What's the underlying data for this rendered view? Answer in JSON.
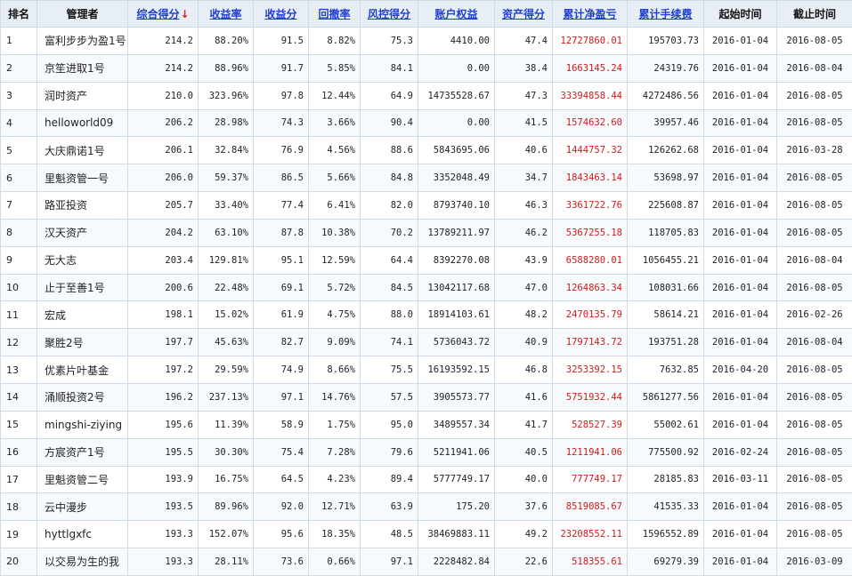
{
  "headers": {
    "rank": "排名",
    "manager": "管理者",
    "overall_score": "综合得分",
    "return_rate": "收益率",
    "return_score": "收益分",
    "drawdown": "回撤率",
    "risk_score": "风控得分",
    "equity": "账户权益",
    "asset_score": "资产得分",
    "cum_pnl": "累计净盈亏",
    "cum_fee": "累计手续费",
    "start_date": "起始时间",
    "end_date": "截止时间"
  },
  "sort_indicator": "↓",
  "rows": [
    {
      "rank": "1",
      "manager": "富利步步为盈1号",
      "overall": "214.2",
      "return_rate": "88.20%",
      "return_score": "91.5",
      "drawdown": "8.82%",
      "risk": "75.3",
      "equity": "4410.00",
      "asset": "47.4",
      "pnl": "12727860.01",
      "fee": "195703.73",
      "start": "2016-01-04",
      "end": "2016-08-05"
    },
    {
      "rank": "2",
      "manager": "京笙进取1号",
      "overall": "214.2",
      "return_rate": "88.96%",
      "return_score": "91.7",
      "drawdown": "5.85%",
      "risk": "84.1",
      "equity": "0.00",
      "asset": "38.4",
      "pnl": "1663145.24",
      "fee": "24319.76",
      "start": "2016-01-04",
      "end": "2016-08-04"
    },
    {
      "rank": "3",
      "manager": "润时资产",
      "overall": "210.0",
      "return_rate": "323.96%",
      "return_score": "97.8",
      "drawdown": "12.44%",
      "risk": "64.9",
      "equity": "14735528.67",
      "asset": "47.3",
      "pnl": "33394858.44",
      "fee": "4272486.56",
      "start": "2016-01-04",
      "end": "2016-08-05"
    },
    {
      "rank": "4",
      "manager": "helloworld09",
      "overall": "206.2",
      "return_rate": "28.98%",
      "return_score": "74.3",
      "drawdown": "3.66%",
      "risk": "90.4",
      "equity": "0.00",
      "asset": "41.5",
      "pnl": "1574632.60",
      "fee": "39957.46",
      "start": "2016-01-04",
      "end": "2016-08-05"
    },
    {
      "rank": "5",
      "manager": "大庆鼎诺1号",
      "overall": "206.1",
      "return_rate": "32.84%",
      "return_score": "76.9",
      "drawdown": "4.56%",
      "risk": "88.6",
      "equity": "5843695.06",
      "asset": "40.6",
      "pnl": "1444757.32",
      "fee": "126262.68",
      "start": "2016-01-04",
      "end": "2016-03-28"
    },
    {
      "rank": "6",
      "manager": "里魁资管一号",
      "overall": "206.0",
      "return_rate": "59.37%",
      "return_score": "86.5",
      "drawdown": "5.66%",
      "risk": "84.8",
      "equity": "3352048.49",
      "asset": "34.7",
      "pnl": "1843463.14",
      "fee": "53698.97",
      "start": "2016-01-04",
      "end": "2016-08-05"
    },
    {
      "rank": "7",
      "manager": "路亚投资",
      "overall": "205.7",
      "return_rate": "33.40%",
      "return_score": "77.4",
      "drawdown": "6.41%",
      "risk": "82.0",
      "equity": "8793740.10",
      "asset": "46.3",
      "pnl": "3361722.76",
      "fee": "225608.87",
      "start": "2016-01-04",
      "end": "2016-08-05"
    },
    {
      "rank": "8",
      "manager": "汉天资产",
      "overall": "204.2",
      "return_rate": "63.10%",
      "return_score": "87.8",
      "drawdown": "10.38%",
      "risk": "70.2",
      "equity": "13789211.97",
      "asset": "46.2",
      "pnl": "5367255.18",
      "fee": "118705.83",
      "start": "2016-01-04",
      "end": "2016-08-05"
    },
    {
      "rank": "9",
      "manager": "无大志",
      "overall": "203.4",
      "return_rate": "129.81%",
      "return_score": "95.1",
      "drawdown": "12.59%",
      "risk": "64.4",
      "equity": "8392270.08",
      "asset": "43.9",
      "pnl": "6588280.01",
      "fee": "1056455.21",
      "start": "2016-01-04",
      "end": "2016-08-04"
    },
    {
      "rank": "10",
      "manager": "止于至善1号",
      "overall": "200.6",
      "return_rate": "22.48%",
      "return_score": "69.1",
      "drawdown": "5.72%",
      "risk": "84.5",
      "equity": "13042117.68",
      "asset": "47.0",
      "pnl": "1264863.34",
      "fee": "108031.66",
      "start": "2016-01-04",
      "end": "2016-08-05"
    },
    {
      "rank": "11",
      "manager": "宏成",
      "overall": "198.1",
      "return_rate": "15.02%",
      "return_score": "61.9",
      "drawdown": "4.75%",
      "risk": "88.0",
      "equity": "18914103.61",
      "asset": "48.2",
      "pnl": "2470135.79",
      "fee": "58614.21",
      "start": "2016-01-04",
      "end": "2016-02-26"
    },
    {
      "rank": "12",
      "manager": "聚胜2号",
      "overall": "197.7",
      "return_rate": "45.63%",
      "return_score": "82.7",
      "drawdown": "9.09%",
      "risk": "74.1",
      "equity": "5736043.72",
      "asset": "40.9",
      "pnl": "1797143.72",
      "fee": "193751.28",
      "start": "2016-01-04",
      "end": "2016-08-04"
    },
    {
      "rank": "13",
      "manager": "优素片叶基金",
      "overall": "197.2",
      "return_rate": "29.59%",
      "return_score": "74.9",
      "drawdown": "8.66%",
      "risk": "75.5",
      "equity": "16193592.15",
      "asset": "46.8",
      "pnl": "3253392.15",
      "fee": "7632.85",
      "start": "2016-04-20",
      "end": "2016-08-05"
    },
    {
      "rank": "14",
      "manager": "涌顺投资2号",
      "overall": "196.2",
      "return_rate": "237.13%",
      "return_score": "97.1",
      "drawdown": "14.76%",
      "risk": "57.5",
      "equity": "3905573.77",
      "asset": "41.6",
      "pnl": "5751932.44",
      "fee": "5861277.56",
      "start": "2016-01-04",
      "end": "2016-08-05"
    },
    {
      "rank": "15",
      "manager": "mingshi-ziying",
      "overall": "195.6",
      "return_rate": "11.39%",
      "return_score": "58.9",
      "drawdown": "1.75%",
      "risk": "95.0",
      "equity": "3489557.34",
      "asset": "41.7",
      "pnl": "528527.39",
      "fee": "55002.61",
      "start": "2016-01-04",
      "end": "2016-08-05"
    },
    {
      "rank": "16",
      "manager": "方宸资产1号",
      "overall": "195.5",
      "return_rate": "30.30%",
      "return_score": "75.4",
      "drawdown": "7.28%",
      "risk": "79.6",
      "equity": "5211941.06",
      "asset": "40.5",
      "pnl": "1211941.06",
      "fee": "775500.92",
      "start": "2016-02-24",
      "end": "2016-08-05"
    },
    {
      "rank": "17",
      "manager": "里魁资管二号",
      "overall": "193.9",
      "return_rate": "16.75%",
      "return_score": "64.5",
      "drawdown": "4.23%",
      "risk": "89.4",
      "equity": "5777749.17",
      "asset": "40.0",
      "pnl": "777749.17",
      "fee": "28185.83",
      "start": "2016-03-11",
      "end": "2016-08-05"
    },
    {
      "rank": "18",
      "manager": "云中漫步",
      "overall": "193.5",
      "return_rate": "89.96%",
      "return_score": "92.0",
      "drawdown": "12.71%",
      "risk": "63.9",
      "equity": "175.20",
      "asset": "37.6",
      "pnl": "8519085.67",
      "fee": "41535.33",
      "start": "2016-01-04",
      "end": "2016-08-05"
    },
    {
      "rank": "19",
      "manager": "hyttlgxfc",
      "overall": "193.3",
      "return_rate": "152.07%",
      "return_score": "95.6",
      "drawdown": "18.35%",
      "risk": "48.5",
      "equity": "38469883.11",
      "asset": "49.2",
      "pnl": "23208552.11",
      "fee": "1596552.89",
      "start": "2016-01-04",
      "end": "2016-08-05"
    },
    {
      "rank": "20",
      "manager": "以交易为生的我",
      "overall": "193.3",
      "return_rate": "28.11%",
      "return_score": "73.6",
      "drawdown": "0.66%",
      "risk": "97.1",
      "equity": "2228482.84",
      "asset": "22.6",
      "pnl": "518355.61",
      "fee": "69279.39",
      "start": "2016-01-04",
      "end": "2016-03-09"
    }
  ],
  "colors": {
    "header_bg": "#e7eef6",
    "link_blue": "#1f3fd1",
    "pnl_red": "#d11a1a",
    "border": "#cfdbe6"
  }
}
